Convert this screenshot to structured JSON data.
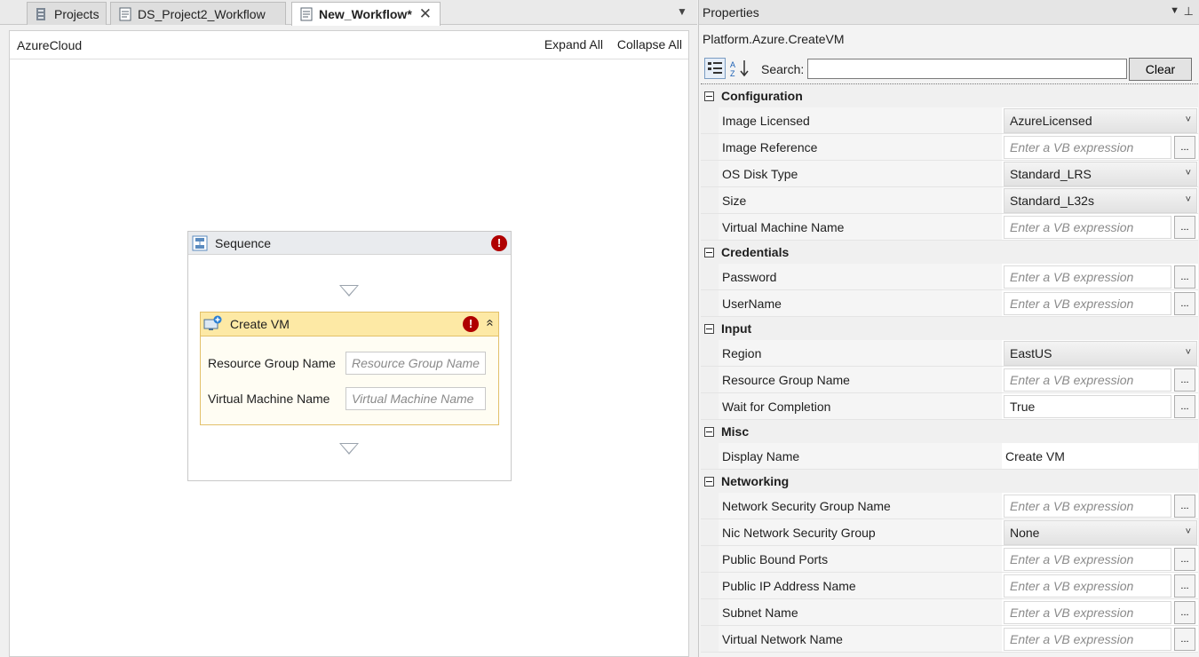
{
  "tabs": [
    {
      "label": "Projects",
      "icon": "projects-icon",
      "active": false
    },
    {
      "label": "DS_Project2_Workflow",
      "icon": "workflow-icon",
      "active": false
    },
    {
      "label": "New_Workflow*",
      "icon": "workflow-icon",
      "active": true,
      "close": "✕"
    }
  ],
  "designer": {
    "breadcrumb": "AzureCloud",
    "expand_all": "Expand All",
    "collapse_all": "Collapse All",
    "sequence": {
      "title": "Sequence",
      "error": "!",
      "activity": {
        "title": "Create VM",
        "error": "!",
        "collapse": "«",
        "fields": [
          {
            "label": "Resource Group Name",
            "placeholder": "Resource Group Name"
          },
          {
            "label": "Virtual Machine Name",
            "placeholder": "Virtual Machine Name"
          }
        ]
      }
    }
  },
  "properties": {
    "title": "Properties",
    "type": "Platform.Azure.CreateVM",
    "search_label": "Search:",
    "clear_label": "Clear",
    "ellipsis": "...",
    "categories": [
      {
        "name": "Configuration",
        "rows": [
          {
            "name": "Image Licensed",
            "kind": "select",
            "value": "AzureLicensed"
          },
          {
            "name": "Image Reference",
            "kind": "vb",
            "value": "Enter a VB expression"
          },
          {
            "name": "OS Disk Type",
            "kind": "select",
            "value": "Standard_LRS"
          },
          {
            "name": "Size",
            "kind": "select",
            "value": "Standard_L32s"
          },
          {
            "name": "Virtual Machine Name",
            "kind": "vb",
            "value": "Enter a VB expression"
          }
        ]
      },
      {
        "name": "Credentials",
        "rows": [
          {
            "name": "Password",
            "kind": "vb",
            "value": "Enter a VB expression"
          },
          {
            "name": "UserName",
            "kind": "vb",
            "value": "Enter a VB expression"
          }
        ]
      },
      {
        "name": "Input",
        "rows": [
          {
            "name": "Region",
            "kind": "select",
            "value": "EastUS"
          },
          {
            "name": "Resource Group Name",
            "kind": "vb",
            "value": "Enter a VB expression"
          },
          {
            "name": "Wait for Completion",
            "kind": "vbval",
            "value": "True"
          }
        ]
      },
      {
        "name": "Misc",
        "rows": [
          {
            "name": "Display Name",
            "kind": "plain",
            "value": "Create VM"
          }
        ]
      },
      {
        "name": "Networking",
        "rows": [
          {
            "name": "Network Security Group Name",
            "kind": "vb",
            "value": "Enter a VB expression"
          },
          {
            "name": "Nic Network Security Group",
            "kind": "select",
            "value": "None"
          },
          {
            "name": "Public Bound Ports",
            "kind": "vb",
            "value": "Enter a VB expression"
          },
          {
            "name": "Public IP Address Name",
            "kind": "vb",
            "value": "Enter a VB expression"
          },
          {
            "name": "Subnet Name",
            "kind": "vb",
            "value": "Enter a VB expression"
          },
          {
            "name": "Virtual Network Name",
            "kind": "vb",
            "value": "Enter a VB expression"
          }
        ]
      }
    ]
  }
}
